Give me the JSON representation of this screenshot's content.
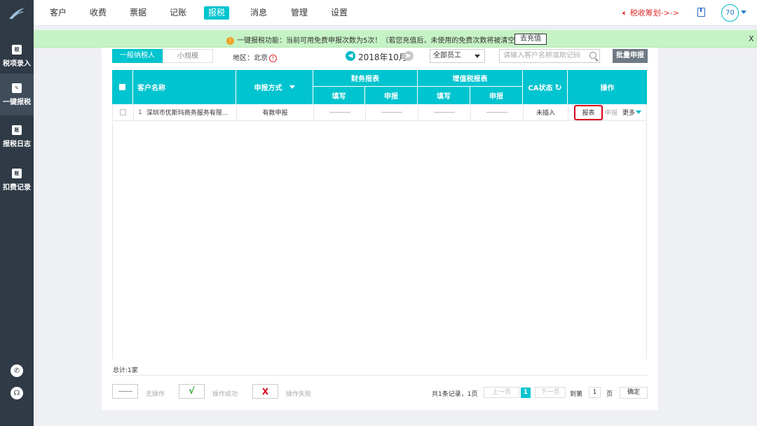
{
  "sidebar": {
    "items": [
      {
        "label": "税项录入",
        "icon": "税"
      },
      {
        "label": "一键报税",
        "icon": "✎"
      },
      {
        "label": "报税日志",
        "icon": "账"
      },
      {
        "label": "扣费记录",
        "icon": "账"
      }
    ]
  },
  "topnav": {
    "items": [
      "客户",
      "收费",
      "票据",
      "记账",
      "报税",
      "消息",
      "管理",
      "设置"
    ],
    "active": "报税",
    "promo": "税收筹划->->",
    "avatar": "70"
  },
  "notice": {
    "text": "一键报税功能：当前可用免费申报次数为5次！（若您充值后，未使用的免费次数将被清空）",
    "recharge_label": "去充值",
    "close_label": "X"
  },
  "toolbar": {
    "tab_general": "一般纳税人",
    "tab_small": "小规模",
    "region_label": "地区：北京",
    "month": "2018年10月",
    "employee_select": "全部员工",
    "search_placeholder": "请输入客户名称或助记码",
    "batch_label": "批量申报"
  },
  "table": {
    "headers": {
      "name": "客户名称",
      "method": "申报方式",
      "financial": "财务报表",
      "vat": "增值税报表",
      "fill": "填写",
      "report": "申报",
      "ca": "CA状态",
      "op": "操作"
    },
    "rows": [
      {
        "index": "1",
        "name": "深圳市优斯玛商务服务有限...",
        "method": "有数申报",
        "ca_status": "未插入",
        "op_report": "报表",
        "op_declare": "申报",
        "op_more": "更多"
      }
    ]
  },
  "footer": {
    "total": "总计:1家",
    "legend_none": "无操作",
    "legend_success": "操作成功",
    "legend_fail": "操作失败",
    "success_mark": "√",
    "fail_mark": "X",
    "records": "共1条记录，1页",
    "prev": "上一页",
    "current_page": "1",
    "next": "下一页",
    "goto": "到第",
    "goto_value": "1",
    "page": "页",
    "confirm": "确定"
  },
  "colors": {
    "accent": "#00c4cf",
    "sidebar": "#2f3a46",
    "notice_bg": "#c6f3c6",
    "alert_red": "#d9001b"
  }
}
